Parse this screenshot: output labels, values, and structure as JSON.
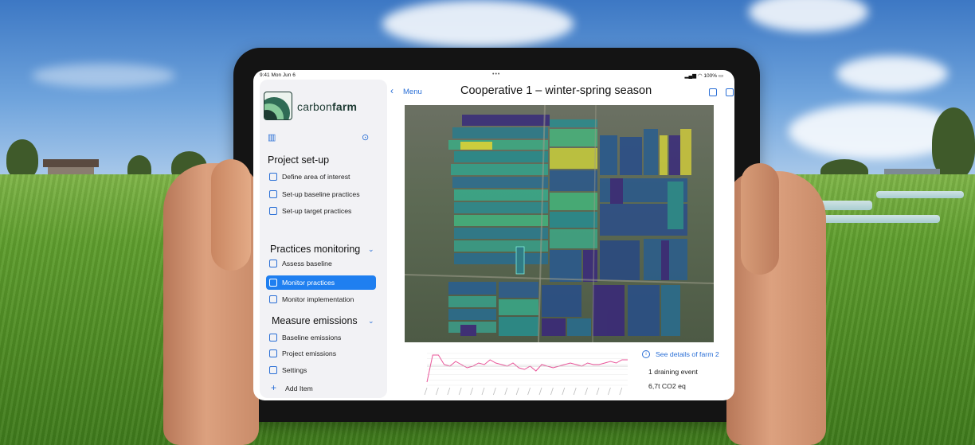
{
  "status_bar": {
    "time": "9:41  Mon Jun 6",
    "dots": "•••",
    "battery": "100%"
  },
  "sidebar": {
    "brand_prefix": "carbon",
    "brand_suffix": "farm",
    "sections": [
      {
        "title": "Project set-up",
        "items": [
          "Define area of interest",
          "Set-up baseline practices",
          "Set-up target practices"
        ]
      },
      {
        "title": "Practices monitoring",
        "items": [
          "Assess baseline",
          "Monitor practices",
          "Monitor implementation"
        ]
      },
      {
        "title": "Measure emissions",
        "items": [
          "Baseline emissions",
          "Project emissions",
          "Settings"
        ]
      }
    ],
    "active_item": "Monitor practices",
    "add_item": "Add Item"
  },
  "header": {
    "back_label": "Menu",
    "title": "Cooperative 1 – winter-spring season"
  },
  "details": {
    "link": "See details of farm 2",
    "event": "1 draining event",
    "emissions": "6,7t CO2 eq"
  },
  "chart_data": {
    "type": "line",
    "x": [
      0,
      1,
      2,
      3,
      4,
      5,
      6,
      7,
      8,
      9,
      10,
      11,
      12,
      13,
      14,
      15,
      16,
      17,
      18,
      19,
      20,
      21,
      22,
      23,
      24,
      25,
      26,
      27,
      28,
      29,
      30,
      31,
      32,
      33,
      34,
      35
    ],
    "series": [
      {
        "values": [
          -0.8,
          0.9,
          0.9,
          0.3,
          0.2,
          0.5,
          0.3,
          0.1,
          0.2,
          0.4,
          0.3,
          0.6,
          0.4,
          0.3,
          0.2,
          0.4,
          0.1,
          0.0,
          0.2,
          -0.1,
          0.3,
          0.2,
          0.1,
          0.2,
          0.3,
          0.4,
          0.3,
          0.2,
          0.4,
          0.3,
          0.3,
          0.4,
          0.5,
          0.4,
          0.6,
          0.6
        ]
      },
      {
        "values": [
          0.2,
          0.2,
          0.2,
          0.2,
          0.2,
          0.2,
          0.2,
          0.2,
          0.2,
          0.2,
          0.2,
          0.2,
          0.2,
          0.2,
          0.2,
          0.2,
          0.2,
          0.2,
          0.2,
          0.2,
          0.2,
          0.2,
          0.2,
          0.2,
          0.2,
          0.2,
          0.2,
          0.2,
          0.2,
          0.2,
          0.2,
          0.2,
          0.2,
          0.2,
          0.2,
          0.2
        ]
      }
    ],
    "ylim": [
      -1,
      1
    ],
    "colors": [
      "#e9569a",
      "#b0b0b0"
    ],
    "grid": true
  }
}
